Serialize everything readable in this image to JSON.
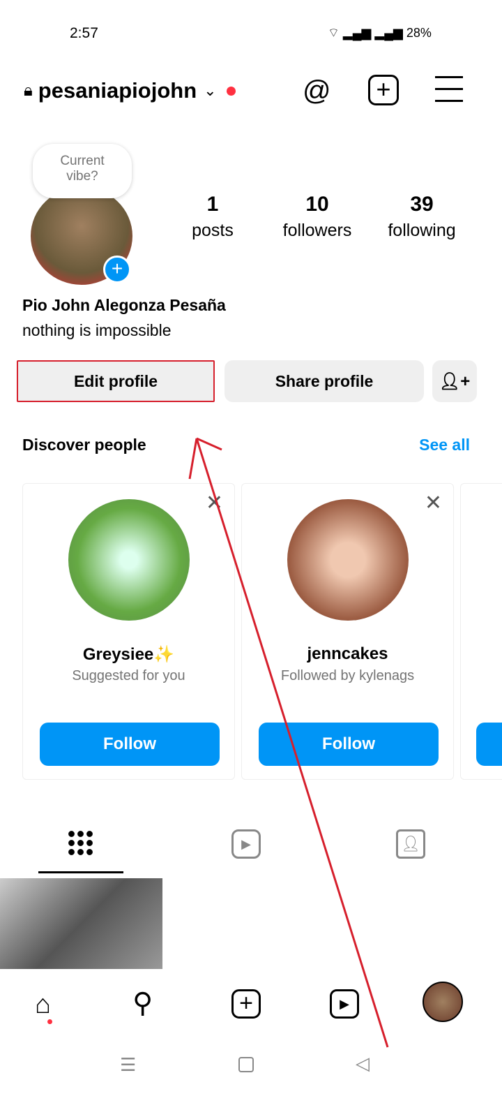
{
  "status_bar": {
    "time": "2:57",
    "battery": "28%"
  },
  "header": {
    "username": "pesaniapiojohn"
  },
  "profile": {
    "note": "Current vibe?",
    "name": "Pio John Alegonza Pesaña",
    "bio": "nothing is impossible",
    "stats": [
      {
        "value": "1",
        "label": "posts"
      },
      {
        "value": "10",
        "label": "followers"
      },
      {
        "value": "39",
        "label": "following"
      }
    ]
  },
  "buttons": {
    "edit": "Edit profile",
    "share": "Share profile"
  },
  "discover": {
    "title": "Discover people",
    "see_all": "See all",
    "cards": [
      {
        "name": "Greysiee✨",
        "sub": "Suggested for you",
        "follow": "Follow"
      },
      {
        "name": "jenncakes",
        "sub": "Followed by kylenags",
        "follow": "Follow"
      }
    ]
  },
  "colors": {
    "accent": "#0095f6",
    "annotation": "#d61f2c",
    "notification": "#ff3040"
  }
}
